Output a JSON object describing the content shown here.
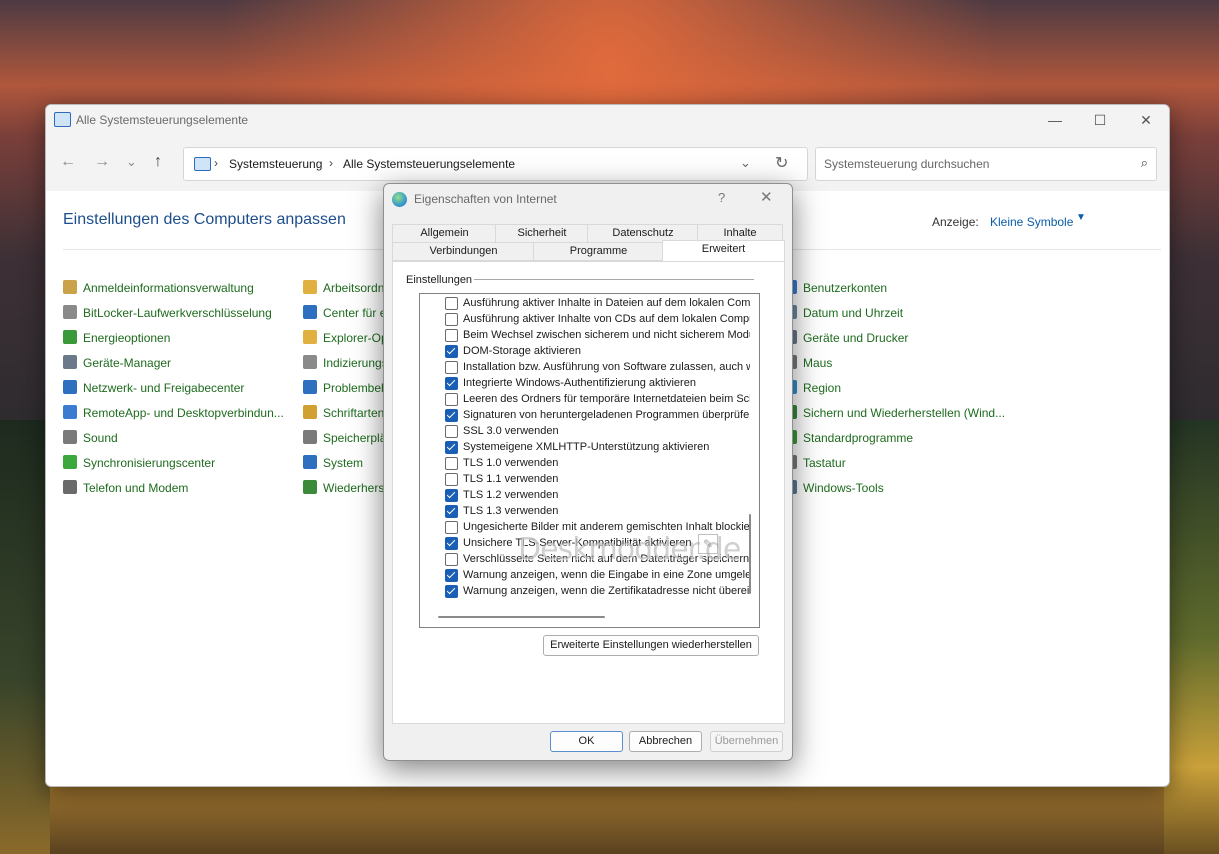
{
  "window": {
    "title": "Alle Systemsteuerungselemente",
    "controls": {
      "minimize": "—",
      "maximize": "☐",
      "close": "✕"
    }
  },
  "nav": {
    "back": "←",
    "forward": "→",
    "recent": "⌄",
    "up": "↑",
    "breadcrumb": [
      "Systemsteuerung",
      "Alle Systemsteuerungselemente"
    ],
    "separator": "›",
    "dropdown": "⌄",
    "refresh": "↻",
    "search_placeholder": "Systemsteuerung durchsuchen",
    "search_icon": "⌕"
  },
  "main": {
    "title": "Einstellungen des Computers anpassen",
    "view_label": "Anzeige:",
    "view_value": "Kleine Symbole",
    "view_caret": "▼"
  },
  "items": {
    "col1": [
      {
        "label": "Anmeldeinformationsverwaltung",
        "icon": "credential-manager-icon",
        "color": "#c9a24a"
      },
      {
        "label": "BitLocker-Laufwerkverschlüsselung",
        "icon": "bitlocker-icon",
        "color": "#8a8a8a"
      },
      {
        "label": "Energieoptionen",
        "icon": "power-options-icon",
        "color": "#3a9a3a"
      },
      {
        "label": "Geräte-Manager",
        "icon": "device-manager-icon",
        "color": "#6a7a8a"
      },
      {
        "label": "Netzwerk- und Freigabecenter",
        "icon": "network-icon",
        "color": "#2f6fc0"
      },
      {
        "label": "RemoteApp- und Desktopverbindun...",
        "icon": "remoteapp-icon",
        "color": "#3b7bd0"
      },
      {
        "label": "Sound",
        "icon": "sound-icon",
        "color": "#7a7a7a"
      },
      {
        "label": "Synchronisierungscenter",
        "icon": "sync-center-icon",
        "color": "#3aa83a"
      },
      {
        "label": "Telefon und Modem",
        "icon": "phone-modem-icon",
        "color": "#6a6a6a"
      }
    ],
    "col2": [
      {
        "label": "Arbeitsordner",
        "icon": "work-folders-icon",
        "color": "#e0b040"
      },
      {
        "label": "Center für erleichterte Bedienung",
        "icon": "ease-of-access-icon",
        "color": "#2f6fc0"
      },
      {
        "label": "Explorer-Optionen",
        "icon": "explorer-options-icon",
        "color": "#e0b040"
      },
      {
        "label": "Indizierungsoptionen",
        "icon": "indexing-icon",
        "color": "#8a8a8a"
      },
      {
        "label": "Problembehandlung",
        "icon": "troubleshooting-icon",
        "color": "#2f6fc0"
      },
      {
        "label": "Schriftarten",
        "icon": "fonts-icon",
        "color": "#d0a030"
      },
      {
        "label": "Speicherplätze",
        "icon": "storage-spaces-icon",
        "color": "#7a7a7a"
      },
      {
        "label": "System",
        "icon": "system-icon",
        "color": "#2f6fc0"
      },
      {
        "label": "Wiederherstellung",
        "icon": "recovery-icon",
        "color": "#3a8a3a"
      }
    ],
    "col3": [
      {
        "label": "Benutzerkonten",
        "icon": "user-accounts-icon",
        "color": "#3b7bd0"
      },
      {
        "label": "Datum und Uhrzeit",
        "icon": "date-time-icon",
        "color": "#6a8aa0"
      },
      {
        "label": "Geräte und Drucker",
        "icon": "devices-printers-icon",
        "color": "#6a7a8a"
      },
      {
        "label": "Maus",
        "icon": "mouse-icon",
        "color": "#7a7a7a"
      },
      {
        "label": "Region",
        "icon": "region-icon",
        "color": "#2f8fd0"
      },
      {
        "label": "Sichern und Wiederherstellen (Wind...",
        "icon": "backup-restore-icon",
        "color": "#3a8a3a"
      },
      {
        "label": "Standardprogramme",
        "icon": "default-programs-icon",
        "color": "#3a9a3a"
      },
      {
        "label": "Tastatur",
        "icon": "keyboard-icon",
        "color": "#7a7a7a"
      },
      {
        "label": "Windows-Tools",
        "icon": "windows-tools-icon",
        "color": "#5a7a9a"
      }
    ]
  },
  "dialog": {
    "title": "Eigenschaften von Internet",
    "help": "?",
    "close": "✕",
    "tabs_row1": [
      "Allgemein",
      "Sicherheit",
      "Datenschutz",
      "Inhalte"
    ],
    "tabs_row2": [
      "Verbindungen",
      "Programme",
      "Erweitert"
    ],
    "active_tab": "Erweitert",
    "group_label": "Einstellungen",
    "settings": [
      {
        "label": "Ausführung aktiver Inhalte in Dateien auf dem lokalen Computer zulassen",
        "checked": false
      },
      {
        "label": "Ausführung aktiver Inhalte von CDs auf dem lokalen Computer zulassen",
        "checked": false
      },
      {
        "label": "Beim Wechsel zwischen sicherem und nicht sicherem Modus warnen",
        "checked": false
      },
      {
        "label": "DOM-Storage aktivieren",
        "checked": true
      },
      {
        "label": "Installation bzw. Ausführung von Software zulassen, auch wenn die Signatur ungültig ist",
        "checked": false
      },
      {
        "label": "Integrierte Windows-Authentifizierung aktivieren",
        "checked": true
      },
      {
        "label": "Leeren des Ordners für temporäre Internetdateien beim Schließen des Browsers",
        "checked": false
      },
      {
        "label": "Signaturen von heruntergeladenen Programmen überprüfen",
        "checked": true
      },
      {
        "label": "SSL 3.0 verwenden",
        "checked": false
      },
      {
        "label": "Systemeigene XMLHTTP-Unterstützung aktivieren",
        "checked": true
      },
      {
        "label": "TLS 1.0 verwenden",
        "checked": false
      },
      {
        "label": "TLS 1.1 verwenden",
        "checked": false
      },
      {
        "label": "TLS 1.2 verwenden",
        "checked": true
      },
      {
        "label": "TLS 1.3 verwenden",
        "checked": true
      },
      {
        "label": "Ungesicherte Bilder mit anderem gemischten Inhalt blockieren",
        "checked": false
      },
      {
        "label": "Unsichere TLS-Server-Kompatibilität aktivieren",
        "checked": true
      },
      {
        "label": "Verschlüsselte Seiten nicht auf dem Datenträger speichern",
        "checked": false
      },
      {
        "label": "Warnung anzeigen, wenn die Eingabe in eine Zone umgeleitet wird",
        "checked": true
      },
      {
        "label": "Warnung anzeigen, wenn die Zertifikatadresse nicht übereinstimmt",
        "checked": true
      }
    ],
    "restore_button": "Erweiterte Einstellungen wiederherstellen",
    "ok": "OK",
    "cancel": "Abbrechen",
    "apply": "Übernehmen",
    "watermark": "Deskmodder.de"
  }
}
